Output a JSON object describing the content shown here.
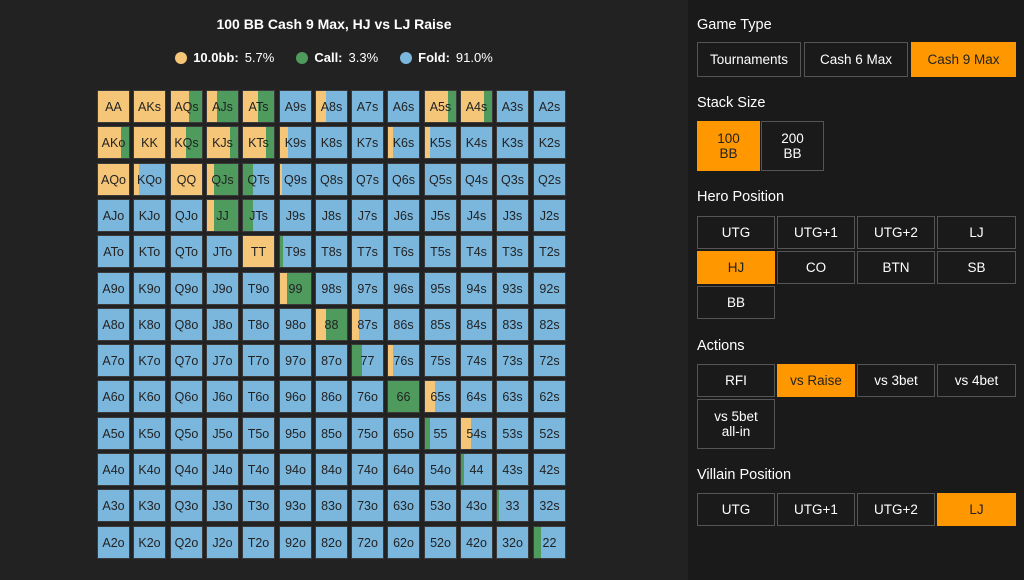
{
  "chart": {
    "title": "100 BB Cash 9 Max, HJ vs LJ Raise",
    "legend": [
      {
        "label": "10.0bb:",
        "value": "5.7%",
        "color": "#f5c578"
      },
      {
        "label": "Call:",
        "value": "3.3%",
        "color": "#4f9a5d"
      },
      {
        "label": "Fold:",
        "value": "91.0%",
        "color": "#7bb6dd"
      }
    ]
  },
  "chart_data": {
    "type": "heatmap",
    "title": "100 BB Cash 9 Max, HJ vs LJ Raise",
    "colors": {
      "raise": "#f5c578",
      "call": "#4f9a5d",
      "fold": "#7bb6dd"
    },
    "summary": {
      "raise": 5.7,
      "call": 3.3,
      "fold": 91.0
    },
    "rows": [
      [
        "AA",
        "AKs",
        "AQs",
        "AJs",
        "ATs",
        "A9s",
        "A8s",
        "A7s",
        "A6s",
        "A5s",
        "A4s",
        "A3s",
        "A2s"
      ],
      [
        "AKo",
        "KK",
        "KQs",
        "KJs",
        "KTs",
        "K9s",
        "K8s",
        "K7s",
        "K6s",
        "K5s",
        "K4s",
        "K3s",
        "K2s"
      ],
      [
        "AQo",
        "KQo",
        "QQ",
        "QJs",
        "QTs",
        "Q9s",
        "Q8s",
        "Q7s",
        "Q6s",
        "Q5s",
        "Q4s",
        "Q3s",
        "Q2s"
      ],
      [
        "AJo",
        "KJo",
        "QJo",
        "JJ",
        "JTs",
        "J9s",
        "J8s",
        "J7s",
        "J6s",
        "J5s",
        "J4s",
        "J3s",
        "J2s"
      ],
      [
        "ATo",
        "KTo",
        "QTo",
        "JTo",
        "TT",
        "T9s",
        "T8s",
        "T7s",
        "T6s",
        "T5s",
        "T4s",
        "T3s",
        "T2s"
      ],
      [
        "A9o",
        "K9o",
        "Q9o",
        "J9o",
        "T9o",
        "99",
        "98s",
        "97s",
        "96s",
        "95s",
        "94s",
        "93s",
        "92s"
      ],
      [
        "A8o",
        "K8o",
        "Q8o",
        "J8o",
        "T8o",
        "98o",
        "88",
        "87s",
        "86s",
        "85s",
        "84s",
        "83s",
        "82s"
      ],
      [
        "A7o",
        "K7o",
        "Q7o",
        "J7o",
        "T7o",
        "97o",
        "87o",
        "77",
        "76s",
        "75s",
        "74s",
        "73s",
        "72s"
      ],
      [
        "A6o",
        "K6o",
        "Q6o",
        "J6o",
        "T6o",
        "96o",
        "86o",
        "76o",
        "66",
        "65s",
        "64s",
        "63s",
        "62s"
      ],
      [
        "A5o",
        "K5o",
        "Q5o",
        "J5o",
        "T5o",
        "95o",
        "85o",
        "75o",
        "65o",
        "55",
        "54s",
        "53s",
        "52s"
      ],
      [
        "A4o",
        "K4o",
        "Q4o",
        "J4o",
        "T4o",
        "94o",
        "84o",
        "74o",
        "64o",
        "54o",
        "44",
        "43s",
        "42s"
      ],
      [
        "A3o",
        "K3o",
        "Q3o",
        "J3o",
        "T3o",
        "93o",
        "83o",
        "73o",
        "63o",
        "53o",
        "43o",
        "33",
        "32s"
      ],
      [
        "A2o",
        "K2o",
        "Q2o",
        "J2o",
        "T2o",
        "92o",
        "82o",
        "72o",
        "62o",
        "52o",
        "42o",
        "32o",
        "22"
      ]
    ],
    "frequencies": {
      "AA": [
        1,
        0
      ],
      "AKs": [
        1,
        0
      ],
      "AQs": [
        0.55,
        0.45
      ],
      "AJs": [
        0.3,
        0.7
      ],
      "ATs": [
        0.45,
        0.55
      ],
      "A8s": [
        0.3,
        0
      ],
      "A5s": [
        0.7,
        0.3
      ],
      "A4s": [
        0.7,
        0.3
      ],
      "AKo": [
        0.7,
        0.3
      ],
      "KK": [
        1,
        0
      ],
      "KQs": [
        0.45,
        0.55
      ],
      "KJs": [
        0.7,
        0.3
      ],
      "KTs": [
        0.7,
        0.3
      ],
      "K9s": [
        0.25,
        0
      ],
      "K6s": [
        0.15,
        0
      ],
      "K5s": [
        0.15,
        0
      ],
      "AQo": [
        1,
        0
      ],
      "KQo": [
        0.15,
        0
      ],
      "QQ": [
        1,
        0
      ],
      "QJs": [
        0.2,
        0.8
      ],
      "QTs": [
        0,
        0.3
      ],
      "Q9s": [
        0.05,
        0
      ],
      "JJ": [
        0.2,
        0.8
      ],
      "JTs": [
        0,
        0.3
      ],
      "TT": [
        1,
        0
      ],
      "T9s": [
        0,
        0.1
      ],
      "99": [
        0.2,
        0.8
      ],
      "88": [
        0.3,
        0.7
      ],
      "87s": [
        0.2,
        0
      ],
      "77": [
        0,
        0.3
      ],
      "76s": [
        0.15,
        0
      ],
      "66": [
        0,
        1
      ],
      "65s": [
        0.3,
        0
      ],
      "55": [
        0,
        0.15
      ],
      "54s": [
        0.3,
        0
      ],
      "44": [
        0,
        0.1
      ],
      "33": [
        0,
        0.05
      ],
      "22": [
        0,
        0.2
      ]
    }
  },
  "panel": {
    "game_type": {
      "title": "Game Type",
      "options": [
        "Tournaments",
        "Cash 6 Max",
        "Cash 9 Max"
      ],
      "selected": "Cash 9 Max"
    },
    "stack_size": {
      "title": "Stack Size",
      "options": [
        [
          "100",
          "BB"
        ],
        [
          "200",
          "BB"
        ]
      ],
      "selected": 0
    },
    "hero_position": {
      "title": "Hero Position",
      "options": [
        "UTG",
        "UTG+1",
        "UTG+2",
        "LJ",
        "HJ",
        "CO",
        "BTN",
        "SB",
        "BB"
      ],
      "selected": "HJ"
    },
    "actions": {
      "title": "Actions",
      "options": [
        "RFI",
        "vs Raise",
        "vs 3bet",
        "vs 4bet",
        [
          "vs 5bet",
          "all-in"
        ]
      ],
      "selected": "vs Raise"
    },
    "villain_position": {
      "title": "Villain Position",
      "options": [
        "UTG",
        "UTG+1",
        "UTG+2",
        "LJ"
      ],
      "selected": "LJ"
    }
  }
}
